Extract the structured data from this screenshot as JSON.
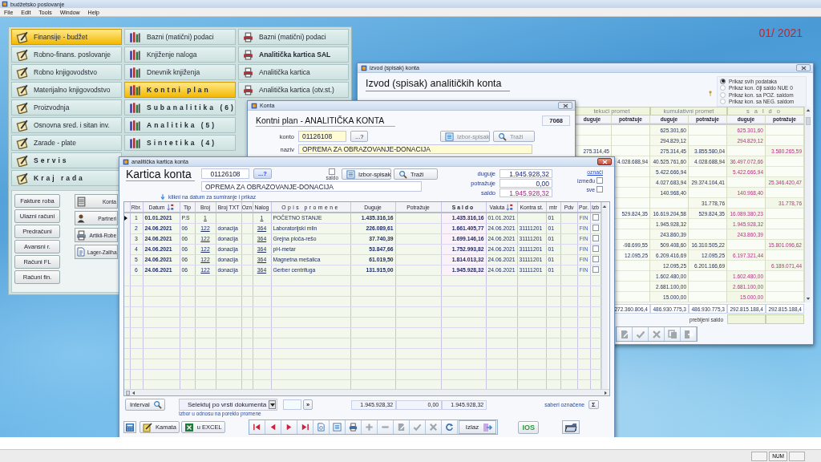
{
  "app": {
    "title": "budžetsko poslovanje",
    "menu": [
      "File",
      "Edit",
      "Tools",
      "Window",
      "Help"
    ],
    "period": "01/ 2021",
    "status": "NUM"
  },
  "main_menu": {
    "modules": [
      {
        "label": "Finansije - budžet",
        "selected": true,
        "kind": "normal"
      },
      {
        "label": "Robno-finans. poslovanje",
        "selected": false,
        "kind": "normal"
      },
      {
        "label": "Robno knjigovodstvo",
        "selected": false,
        "kind": "normal"
      },
      {
        "label": "Materijalno knjigovodstvo",
        "selected": false,
        "kind": "normal"
      },
      {
        "label": "Proizvodnja",
        "selected": false,
        "kind": "normal"
      },
      {
        "label": "Osnovna sred. i sitan inv.",
        "selected": false,
        "kind": "normal"
      },
      {
        "label": "Zarade - plate",
        "selected": false,
        "kind": "normal"
      },
      {
        "label": "Servis",
        "selected": false,
        "kind": "spaced"
      },
      {
        "label": "Kraj rada",
        "selected": false,
        "kind": "spaced"
      }
    ],
    "functions": [
      {
        "label": "Bazni (matični) podaci",
        "selected": false,
        "kind": "normal"
      },
      {
        "label": "Knjiženje naloga",
        "selected": false,
        "kind": "normal"
      },
      {
        "label": "Dnevnik knjiženja",
        "selected": false,
        "kind": "normal"
      },
      {
        "label": "Kontni plan",
        "selected": true,
        "kind": "spaced"
      },
      {
        "label": "Subanalitika (6)",
        "selected": false,
        "kind": "spaced"
      },
      {
        "label": "Analitika (5)",
        "selected": false,
        "kind": "spaced"
      },
      {
        "label": "Sintetika (4)",
        "selected": false,
        "kind": "spaced"
      }
    ],
    "reports": [
      {
        "label": "Bazni (matični) podaci",
        "selected": false,
        "kind": "normal"
      },
      {
        "label": "Analitička kartica SAL",
        "selected": false,
        "kind": "bold"
      },
      {
        "label": "Analitička kartica",
        "selected": false,
        "kind": "normal"
      },
      {
        "label": "Analitička kartica (otv.st.)",
        "selected": false,
        "kind": "normal"
      }
    ],
    "documents": [
      "Fakture roba",
      "Ulazni računi",
      "Predračuni",
      "Avansni r.",
      "Računi FL",
      "Računi fin."
    ],
    "registers": [
      "Konta",
      "Partneri",
      "Artikli-Robe",
      "Lager-Zaliha"
    ]
  },
  "izvod_window": {
    "title": "izvod (spisak) konta",
    "heading": "Izvod (spisak) analitičkih konta",
    "filters": [
      {
        "label": "Prikaz svih podataka",
        "selected": true
      },
      {
        "label": "Prikaz kon. čiji saldo NUE 0",
        "selected": false
      },
      {
        "label": "Prikaz kon. sa POZ. saldom",
        "selected": false
      },
      {
        "label": "Prikaz kon. sa NEG. saldom",
        "selected": false
      }
    ],
    "groups": [
      "tekući promet",
      "kumulativni promet",
      "saldo"
    ],
    "columns": [
      "duguje",
      "potražuje",
      "duguje",
      "potražuje",
      "duguje",
      "potražuje"
    ],
    "rows": [
      [
        null,
        null,
        "625.301,60",
        null,
        "625.301,60",
        null
      ],
      [
        null,
        null,
        "294.829,12",
        null,
        "294.829,12",
        null
      ],
      [
        "275.314,45",
        null,
        "275.314,45",
        "3.855.580,04",
        null,
        "3.580.265,59"
      ],
      [
        null,
        "4.028.688,94",
        "40.525.761,60",
        "4.028.688,94",
        "36.497.072,66",
        null
      ],
      [
        null,
        null,
        "5.422.666,94",
        null,
        "5.422.666,94",
        null
      ],
      [
        null,
        null,
        "4.027.683,94",
        "29.374.104,41",
        null,
        "25.346.420,47"
      ],
      [
        null,
        null,
        "140.968,40",
        null,
        "140.968,40",
        null
      ],
      [
        null,
        null,
        null,
        "31.778,76",
        null,
        "31.778,76"
      ],
      [
        null,
        "529.824,35",
        "16.619.204,58",
        "529.824,35",
        "16.089.380,23",
        null
      ],
      [
        null,
        null,
        "1.945.928,32",
        null,
        "1.945.928,32",
        null
      ],
      [
        null,
        null,
        "243.860,39",
        null,
        "243.860,39",
        null
      ],
      [
        null,
        "-98.699,55",
        "509.408,60",
        "16.310.505,22",
        null,
        "15.801.096,62"
      ],
      [
        null,
        "12.095,25",
        "6.209.416,69",
        "12.095,25",
        "6.197.321,44",
        null
      ],
      [
        null,
        null,
        "12.095,25",
        "6.201.166,69",
        null,
        "6.189.071,44"
      ],
      [
        null,
        null,
        "1.602.480,00",
        null,
        "1.602.480,00",
        null
      ],
      [
        null,
        null,
        "2.681.100,00",
        null,
        "2.681.100,00",
        null
      ],
      [
        null,
        null,
        "15.000,00",
        null,
        "15.000,00",
        null
      ]
    ],
    "totals": [
      "272.360.806,4",
      "486.930.775,3",
      "486.930.775,3",
      "292.815.188,4",
      "292.815.188,4"
    ],
    "balance_label": "prebijeni saldo",
    "toolbar": [
      {
        "kind": "edit",
        "disabled": true
      },
      {
        "kind": "confirm",
        "disabled": true
      },
      {
        "kind": "cancel",
        "disabled": true
      },
      {
        "kind": "copy",
        "disabled": true
      },
      {
        "kind": "exit",
        "disabled": true
      }
    ]
  },
  "konta_window": {
    "title": "Konta",
    "heading": "Kontni plan - ANALITIČKA KONTA",
    "record": "7068",
    "konto_label": "konto",
    "konto": "01126108",
    "lookup": "...?",
    "buttons": [
      {
        "label": "Izbor-spisak",
        "kind": "list",
        "disabled": true
      },
      {
        "label": "Traži",
        "kind": "search",
        "disabled": true
      }
    ],
    "naziv_label": "naziv",
    "naziv": "OPREMA ZA OBRAZOVANJE-DONACIJA"
  },
  "kartica_window": {
    "title": "analitička kartica konta",
    "heading": "Kartica konta",
    "konto": "01126108",
    "lookup": "...?",
    "saldo_check": {
      "label": "saldo",
      "checked": false
    },
    "buttons": [
      {
        "label": "Izbor-spisak",
        "kind": "list",
        "disabled": false
      },
      {
        "label": "Traži",
        "kind": "search",
        "disabled": false
      }
    ],
    "naziv": "OPREMA ZA OBRAZOVANJE-DONACIJA",
    "hint": "klikni na datum za sumiranje i prikaz",
    "summary": [
      {
        "label": "duguje",
        "value": "1.945.928,32",
        "kind": "debit"
      },
      {
        "label": "potražuje",
        "value": "0,00",
        "kind": "credit"
      },
      {
        "label": "saldo",
        "value": "1.945.928,32",
        "kind": "balance"
      }
    ],
    "mark_link": "označi",
    "options": [
      {
        "label": "između",
        "checked": false
      },
      {
        "label": "sve",
        "checked": false
      }
    ],
    "columns": [
      {
        "label": "Rbr.",
        "sortable": false
      },
      {
        "label": "Datum",
        "sortable": true
      },
      {
        "label": "Tip",
        "sortable": false
      },
      {
        "label": "Broj",
        "sortable": false
      },
      {
        "label": "Broj TXT",
        "sortable": false
      },
      {
        "label": "Ozn",
        "sortable": false
      },
      {
        "label": "Nalog",
        "sortable": false
      },
      {
        "label": "Opis promene",
        "sortable": false
      },
      {
        "label": "Duguje",
        "sortable": false
      },
      {
        "label": "Potražuje",
        "sortable": false
      },
      {
        "label": "Saldo",
        "sortable": false
      },
      {
        "label": "Valuta",
        "sortable": true
      },
      {
        "label": "Kontra st.",
        "sortable": false
      },
      {
        "label": "mtr",
        "sortable": false
      },
      {
        "label": "Pdv",
        "sortable": false
      },
      {
        "label": "Por.",
        "sortable": false
      },
      {
        "label": "Izb",
        "sortable": false
      }
    ],
    "rows": [
      {
        "selected": true,
        "checked": false,
        "cells": [
          "1",
          "01.01.2021",
          "P.S",
          "1",
          null,
          null,
          "1",
          "POČETNO STANJE",
          "1.435.316,16",
          null,
          "1.435.316,16",
          "01.01.2021",
          null,
          "01",
          null,
          "FIN"
        ]
      },
      {
        "selected": false,
        "checked": false,
        "cells": [
          "2",
          "24.06.2021",
          "06",
          "122",
          "donacija",
          null,
          "364",
          "Laboratorijski mlin",
          "226.089,61",
          null,
          "1.661.405,77",
          "24.06.2021",
          "31111201",
          "01",
          null,
          "FIN"
        ]
      },
      {
        "selected": false,
        "checked": false,
        "cells": [
          "3",
          "24.06.2021",
          "06",
          "122",
          "donacija",
          null,
          "364",
          "Grejna ploča-rešo",
          "37.740,39",
          null,
          "1.699.146,16",
          "24.06.2021",
          "31111201",
          "01",
          null,
          "FIN"
        ]
      },
      {
        "selected": false,
        "checked": false,
        "cells": [
          "4",
          "24.06.2021",
          "06",
          "122",
          "donacija",
          null,
          "364",
          "pH-metar",
          "53.847,66",
          null,
          "1.752.993,82",
          "24.06.2021",
          "31111201",
          "01",
          null,
          "FIN"
        ]
      },
      {
        "selected": false,
        "checked": false,
        "cells": [
          "5",
          "24.06.2021",
          "06",
          "122",
          "donacija",
          null,
          "364",
          "Magnetna mešalica",
          "61.019,50",
          null,
          "1.814.013,32",
          "24.06.2021",
          "31111201",
          "01",
          null,
          "FIN"
        ]
      },
      {
        "selected": false,
        "checked": false,
        "cells": [
          "6",
          "24.06.2021",
          "06",
          "122",
          "donacija",
          null,
          "364",
          "Gerber centrifuga",
          "131.915,00",
          null,
          "1.945.928,32",
          "24.06.2021",
          "31111201",
          "01",
          null,
          "FIN"
        ]
      }
    ],
    "footer": {
      "interval": "Interval",
      "doc_select": "Selektuj po vrsti dokumenta",
      "doc_hint": "Izbor u odnosu na poreklo promene",
      "go": "»",
      "totals": [
        "1.945.928,32",
        "0,00",
        "1.945.928,32"
      ],
      "sum_label": "saberi označene",
      "sum_button": "Σ"
    },
    "toolbar": {
      "kamata": "Kamata",
      "excel": "u EXCEL",
      "exit": "Izlaz",
      "ios": "IOS",
      "nav": [
        {
          "kind": "first",
          "disabled": false
        },
        {
          "kind": "previous",
          "disabled": false
        },
        {
          "kind": "next",
          "disabled": false
        },
        {
          "kind": "last",
          "disabled": false
        },
        {
          "kind": "preview",
          "disabled": false
        },
        {
          "kind": "list",
          "disabled": false
        },
        {
          "kind": "print",
          "disabled": false
        },
        {
          "kind": "add",
          "disabled": true
        },
        {
          "kind": "remove",
          "disabled": true
        },
        {
          "kind": "edit",
          "disabled": true
        },
        {
          "kind": "confirm",
          "disabled": true
        },
        {
          "kind": "cancel",
          "disabled": true
        },
        {
          "kind": "refresh",
          "disabled": false
        }
      ]
    }
  }
}
